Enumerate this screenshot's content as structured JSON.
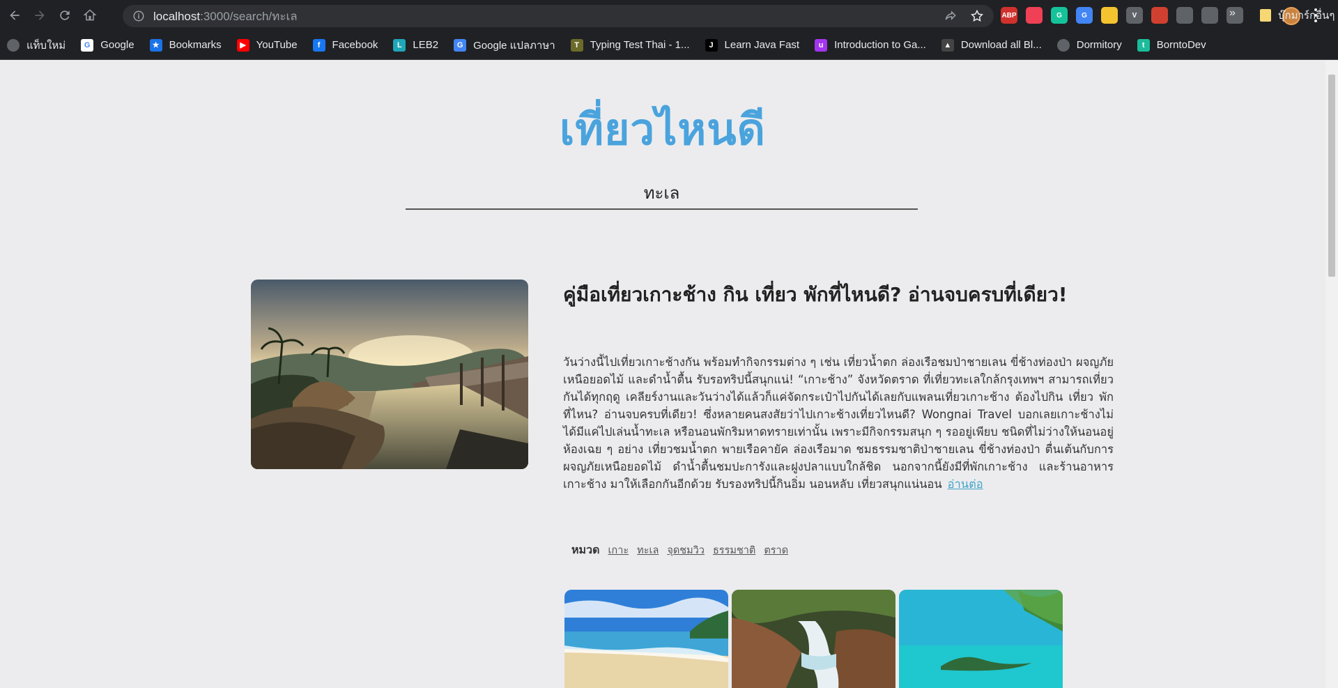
{
  "browser": {
    "url_host": "localhost",
    "url_path": ":3000/search/ทะเล",
    "extensions": [
      {
        "name": "abp-icon",
        "text": "ABP",
        "color": "#d0312d"
      },
      {
        "name": "pocket-icon",
        "text": "",
        "color": "#ef4056"
      },
      {
        "name": "grammarly-icon",
        "text": "G",
        "color": "#15c39a"
      },
      {
        "name": "translate-icon",
        "text": "G",
        "color": "#4285f4"
      },
      {
        "name": "chat-icon",
        "text": "",
        "color": "#f4c430"
      },
      {
        "name": "vee-icon",
        "text": "V",
        "color": "#5f6368"
      },
      {
        "name": "game-icon",
        "text": "",
        "color": "#d04030"
      },
      {
        "name": "puzzle-icon",
        "text": "",
        "color": "#5f6368"
      },
      {
        "name": "media-icon",
        "text": "",
        "color": "#5f6368"
      },
      {
        "name": "sidepanel-icon",
        "text": "",
        "color": "#5f6368"
      }
    ],
    "bookmarks": [
      {
        "label": "แท็บใหม่",
        "icon": "globe-icon",
        "color": "#5f6368",
        "glyph": ""
      },
      {
        "label": "Google",
        "icon": "google-icon",
        "color": "#ffffff",
        "glyph": "G"
      },
      {
        "label": "Bookmarks",
        "icon": "star-icon",
        "color": "#1a73e8",
        "glyph": "★"
      },
      {
        "label": "YouTube",
        "icon": "youtube-icon",
        "color": "#ff0000",
        "glyph": "▶"
      },
      {
        "label": "Facebook",
        "icon": "facebook-icon",
        "color": "#1877f2",
        "glyph": "f"
      },
      {
        "label": "LEB2",
        "icon": "leb2-icon",
        "color": "#1fa6b8",
        "glyph": "L"
      },
      {
        "label": "Google แปลภาษา",
        "icon": "translate-icon",
        "color": "#4285f4",
        "glyph": "G"
      },
      {
        "label": "Typing Test Thai - 1...",
        "icon": "typing-icon",
        "color": "#6b6b2a",
        "glyph": "T"
      },
      {
        "label": "Learn Java Fast",
        "icon": "java-icon",
        "color": "#000000",
        "glyph": "J"
      },
      {
        "label": "Introduction to Ga...",
        "icon": "udemy-icon",
        "color": "#a435f0",
        "glyph": "u"
      },
      {
        "label": "Download all Bl...",
        "icon": "download-icon",
        "color": "#444444",
        "glyph": "▲"
      },
      {
        "label": "Dormitory",
        "icon": "globe-icon",
        "color": "#5f6368",
        "glyph": ""
      },
      {
        "label": "BorntoDev",
        "icon": "borntodev-icon",
        "color": "#1bbc9b",
        "glyph": "t"
      }
    ],
    "more_label": "»",
    "other_bookmarks": "บุ๊กมาร์กอื่นๆ"
  },
  "site": {
    "title": "เที่ยวไหนดี",
    "search_value": "ทะเล"
  },
  "article": {
    "title": " คู่มือเที่ยวเกาะช้าง กิน เที่ยว พักที่ไหนดี? อ่านจบครบที่เดียว!",
    "body": "วันว่างนี้ไปเที่ยวเกาะช้างกัน พร้อมทำกิจกรรมต่าง ๆ เช่น เที่ยวน้ำตก ล่องเรือชมป่าชายเลน ขี่ช้างท่องป่า ผจญภัยเหนือยอดไม้ และดำน้ำตื้น รับรอทริปนี้สนุกแน่! “เกาะช้าง” จังหวัดตราด ที่เที่ยวทะเลใกล้กรุงเทพฯ สามารถเที่ยวกันได้ทุกฤดู เคลียร์งานและวันว่างได้แล้วก็แค่จัดกระเป๋าไปกันได้เลยกับแพลนเที่ยวเกาะช้าง ต้องไปกิน เที่ยว พักที่ไหน? อ่านจบครบที่เดียว! ซึ่งหลายคนสงสัยว่าไปเกาะช้างเที่ยวไหนดี? Wongnai Travel บอกเลยเกาะช้างไม่ได้มีแค่ไปเล่นน้ำทะเล หรือนอนพักริมหาดทรายเท่านั้น เพราะมีกิจกรรมสนุก ๆ รออยู่เพียบ ชนิดที่ไม่ว่างให้นอนอยู่ห้องเฉย ๆ อย่าง เที่ยวชมน้ำตก พายเรือคายัค ล่องเรือมาด ชมธรรมชาติป่าชายเลน ขี่ช้างท่องป่า ตื่นเต้นกับการผจญภัยเหนือยอดไม้ ดำน้ำตื้นชมปะการังและฝูงปลาแบบใกล้ชิด นอกจากนี้ยังมีที่พักเกาะช้าง และร้านอาหารเกาะช้าง มาให้เลือกกันอีกด้วย รับรองทริปนี้กินอิ่ม นอนหลับ เที่ยวสนุกแน่นอน",
    "read_more": "อ่านต่อ",
    "category_label": "หมวด",
    "categories": [
      "เกาะ",
      "ทะเล",
      "จุดชมวิว",
      "ธรรมชาติ",
      "ตราด"
    ]
  }
}
